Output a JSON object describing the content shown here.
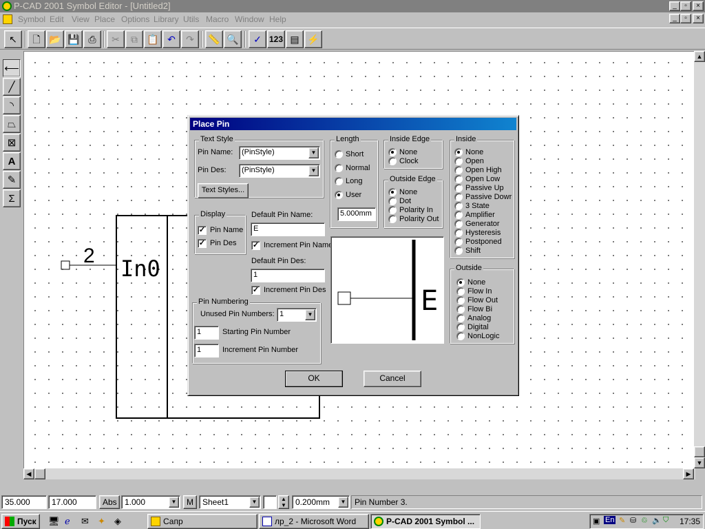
{
  "window": {
    "title": "P-CAD 2001 Symbol Editor - [Untitled2]",
    "controls": [
      "_",
      "▫",
      "×"
    ]
  },
  "menu": [
    "Symbol",
    "Edit",
    "View",
    "Place",
    "Options",
    "Library",
    "Utils",
    "Macro",
    "Window",
    "Help"
  ],
  "toolbar": {
    "num_label": "123"
  },
  "symbol": {
    "pin_number": "2",
    "pin_name": "In0"
  },
  "dialog": {
    "title": "Place Pin",
    "text_style": {
      "legend": "Text Style",
      "pin_name_label": "Pin Name:",
      "pin_name_value": "(PinStyle)",
      "pin_des_label": "Pin Des:",
      "pin_des_value": "(PinStyle)",
      "text_styles_button": "Text Styles..."
    },
    "display": {
      "legend": "Display",
      "pin_name": "Pin Name",
      "pin_des": "Pin Des"
    },
    "default_pin_name_label": "Default Pin Name:",
    "default_pin_name_value": "E",
    "increment_pin_name": "Increment Pin Name",
    "default_pin_des_label": "Default Pin Des:",
    "default_pin_des_value": "1",
    "increment_pin_des": "Increment Pin Des",
    "pin_numbering": {
      "legend": "Pin Numbering",
      "unused_label": "Unused Pin Numbers:",
      "unused_value": "1",
      "starting_value": "1",
      "starting_label": "Starting Pin Number",
      "increment_value": "1",
      "increment_label": "Increment Pin Number"
    },
    "length": {
      "legend": "Length",
      "options": [
        "Short",
        "Normal",
        "Long",
        "User"
      ],
      "selected": "User",
      "user_value": "5.000mm"
    },
    "inside_edge": {
      "legend": "Inside Edge",
      "options": [
        "None",
        "Clock"
      ],
      "selected": "None"
    },
    "outside_edge": {
      "legend": "Outside Edge",
      "options": [
        "None",
        "Dot",
        "Polarity In",
        "Polarity Out"
      ],
      "selected": "None"
    },
    "inside": {
      "legend": "Inside",
      "options": [
        "None",
        "Open",
        "Open High",
        "Open Low",
        "Passive Up",
        "Passive Dowr",
        "3 State",
        "Amplifier",
        "Generator",
        "Hysteresis",
        "Postponed",
        "Shift"
      ],
      "selected": "None"
    },
    "outside": {
      "legend": "Outside",
      "options": [
        "None",
        "Flow In",
        "Flow Out",
        "Flow Bi",
        "Analog",
        "Digital",
        "NonLogic"
      ],
      "selected": "None"
    },
    "preview_label": "E",
    "ok": "OK",
    "cancel": "Cancel"
  },
  "status": {
    "x": "35.000",
    "y": "17.000",
    "abs": "Abs",
    "grid": "1.000",
    "m": "M",
    "sheet": "Sheet1",
    "width": "0.200mm",
    "message": "Pin Number 3."
  },
  "taskbar": {
    "start": "Пуск",
    "tasks": [
      "Сапр",
      "лр_2 - Microsoft Word",
      "P-CAD 2001 Symbol ..."
    ],
    "tray_lang": "En",
    "clock": "17:35"
  }
}
